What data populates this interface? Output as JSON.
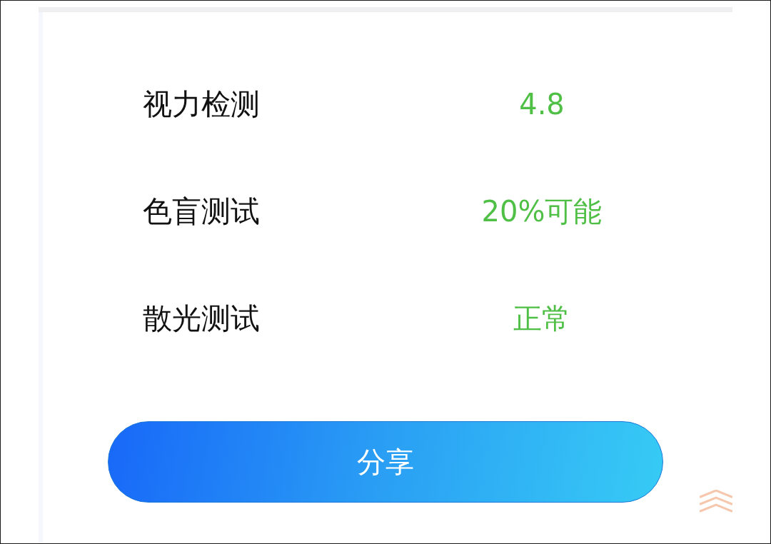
{
  "results": [
    {
      "label": "视力检测",
      "value": "4.8"
    },
    {
      "label": "色盲测试",
      "value": "20%可能"
    },
    {
      "label": "散光测试",
      "value": "正常"
    }
  ],
  "share_button": {
    "label": "分享"
  }
}
